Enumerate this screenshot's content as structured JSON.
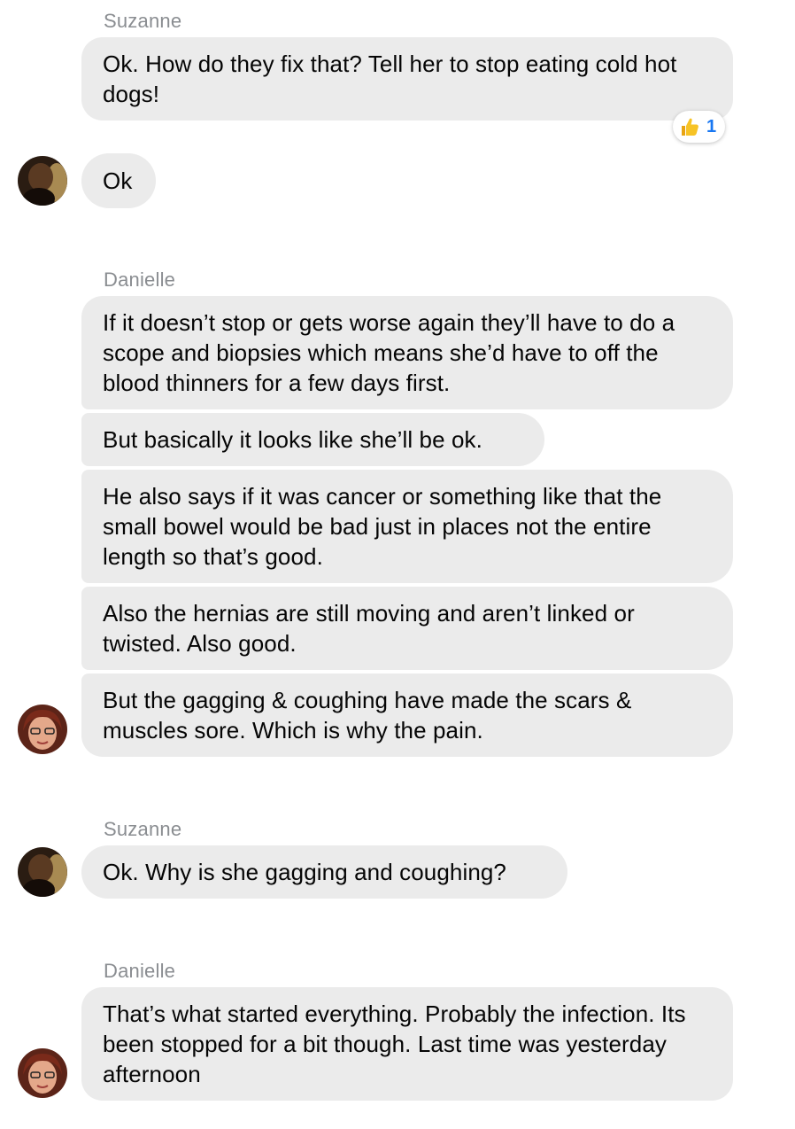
{
  "messages": [
    {
      "sender": "Suzanne",
      "text": "Ok. How do they fix that? Tell her to stop eating cold hot dogs!",
      "reaction": {
        "icon": "thumbs-up-icon",
        "count": "1"
      }
    },
    {
      "text": "Ok"
    },
    {
      "sender": "Danielle",
      "text": "If it doesn’t stop or gets worse again they’ll have to do a scope and biopsies which means she’d have to off the blood thinners for a few days first."
    },
    {
      "text": "But basically it looks like she’ll be ok."
    },
    {
      "text": "He also says if it was cancer or something like that the small bowel would be bad just in places not the entire length so that’s good."
    },
    {
      "text": "Also the hernias are still moving and aren’t linked or twisted. Also good."
    },
    {
      "text": "But the gagging & coughing have made the scars & muscles sore. Which is why the pain."
    },
    {
      "sender": "Suzanne",
      "text": "Ok. Why is she gagging and coughing?"
    },
    {
      "sender": "Danielle",
      "text": "That’s what started everything. Probably the infection. Its been stopped for a bit though. Last time was yesterday afternoon"
    }
  ],
  "colors": {
    "bubble": "#ebebeb",
    "sender_name": "#8a8d91",
    "reaction_count": "#1877f2"
  }
}
